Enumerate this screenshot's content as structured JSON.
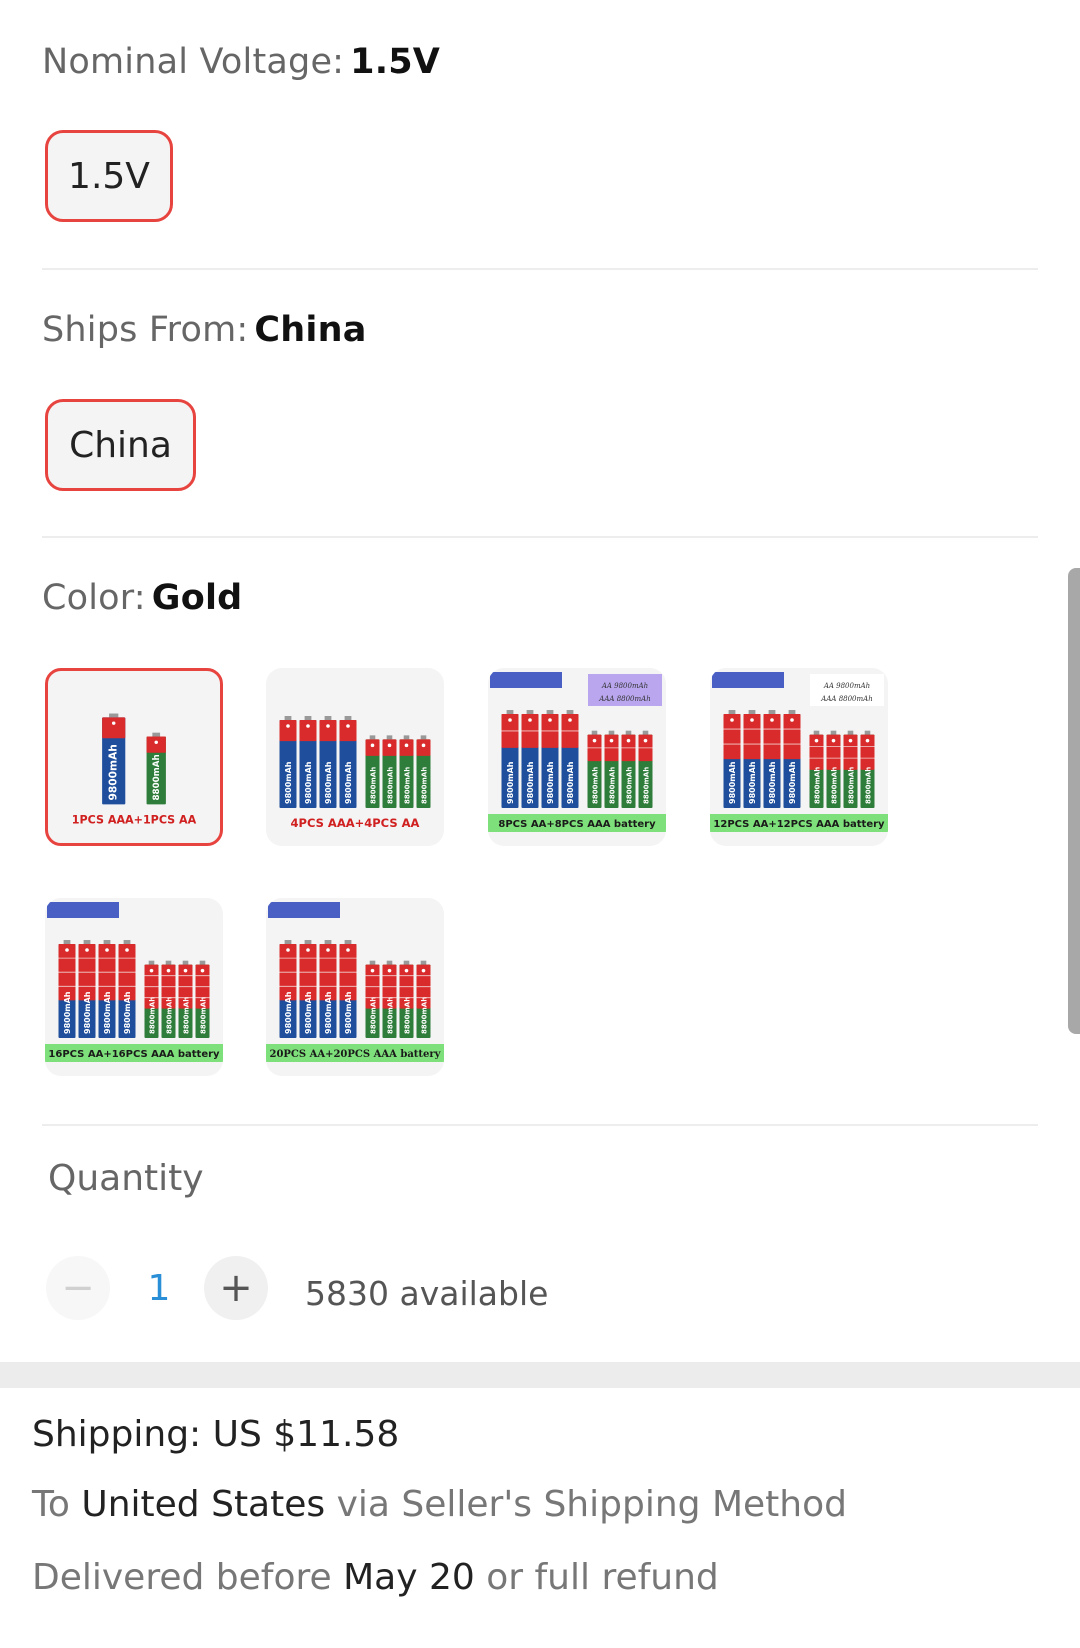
{
  "voltage": {
    "label": "Nominal Voltage:",
    "value": "1.5V",
    "options": [
      "1.5V"
    ]
  },
  "ships_from": {
    "label": "Ships From:",
    "value": "China",
    "options": [
      "China"
    ]
  },
  "color": {
    "label": "Color:",
    "value": "Gold",
    "swatches": [
      {
        "caption": "1PCS AAA+1PCS AA",
        "big_label": "9800mAh",
        "small_label": "8800mAh"
      },
      {
        "caption": "4PCS AAA+4PCS AA",
        "big_label": "9800mAh",
        "small_label": "8800mAh"
      },
      {
        "caption": "8PCS AA+8PCS AAA battery",
        "big_label": "9800mAh",
        "small_label": "8800mAh",
        "note1": "AA 9800mAh",
        "note2": "AAA 8800mAh"
      },
      {
        "caption": "12PCS AA+12PCS AAA battery",
        "big_label": "9800mAh",
        "small_label": "8800mAh",
        "note1": "AA 9800mAh",
        "note2": "AAA 8800mAh"
      },
      {
        "caption": "16PCS AA+16PCS AAA battery",
        "big_label": "9800mAh",
        "small_label": "8800mAh"
      },
      {
        "caption": "20PCS AA+20PCS AAA battery",
        "big_label": "9800mAh",
        "small_label": "8800mAh"
      }
    ]
  },
  "quantity": {
    "label": "Quantity",
    "minus": "−",
    "plus": "+",
    "value": "1",
    "available": "5830 available"
  },
  "shipping": {
    "line1": "Shipping: US $11.58",
    "to_prefix": "To",
    "to_country": "United States",
    "to_suffix": "via Seller's Shipping Method",
    "del_prefix": "Delivered before",
    "del_date": "May 20",
    "del_suffix": "or full refund"
  },
  "colors": {
    "accent": "#e8443f",
    "battery_red": "#d92b2b",
    "battery_blue": "#1f4f9c",
    "battery_green": "#2e7d3a",
    "caption_green": "#7ee07a"
  }
}
